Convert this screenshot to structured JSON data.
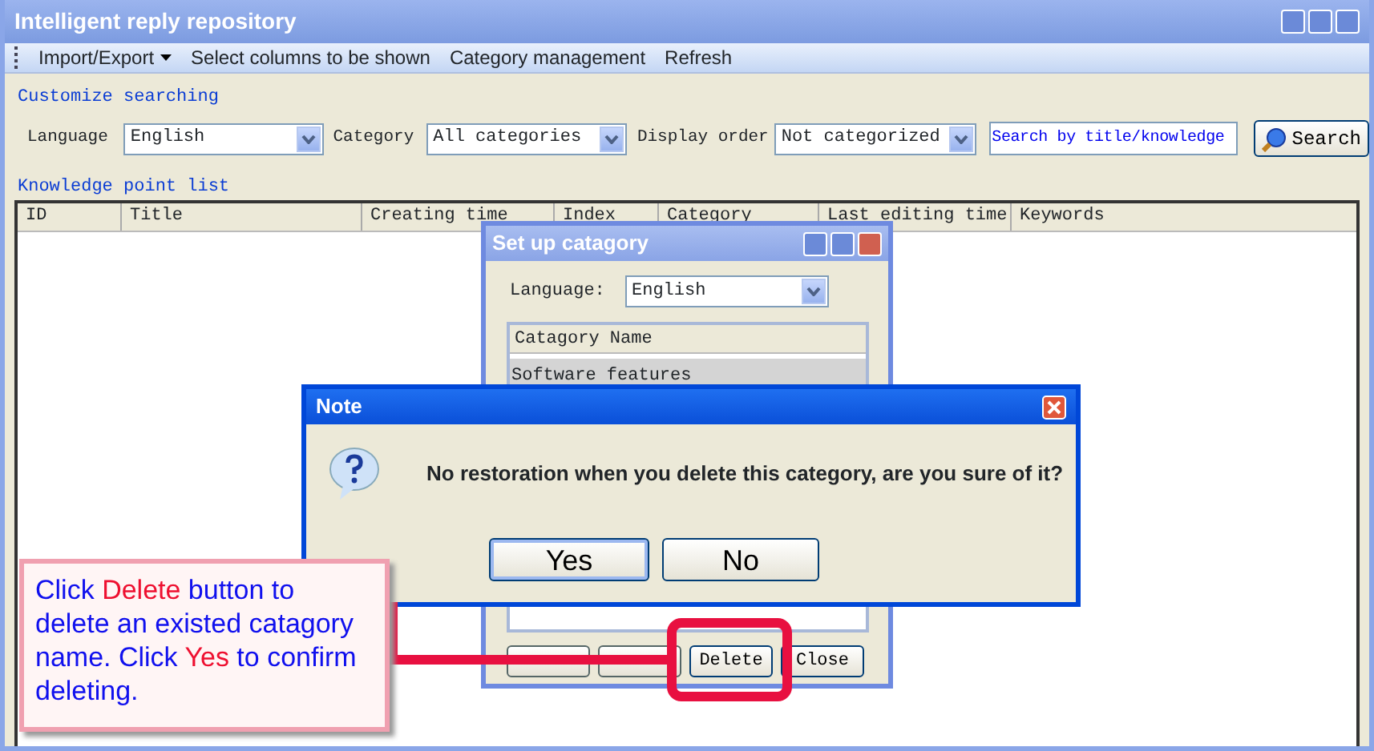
{
  "window": {
    "title": "Intelligent reply repository"
  },
  "menu": [
    {
      "label": "Import/Export",
      "dropdown": true
    },
    {
      "label": "Select columns to be shown",
      "dropdown": false
    },
    {
      "label": "Category management",
      "dropdown": false
    },
    {
      "label": "Refresh",
      "dropdown": false
    }
  ],
  "search": {
    "title": "Customize searching",
    "fields": [
      {
        "label": "Language",
        "value": "English"
      },
      {
        "label": "Category",
        "value": "All categories"
      },
      {
        "label": "Display order",
        "value": "Not categorized"
      }
    ],
    "search_box": {
      "value": "Search by title/knowledge"
    },
    "button": "Search"
  },
  "list": {
    "title": "Knowledge point list",
    "columns": [
      "ID",
      "Title",
      "Creating time",
      "Index",
      "Category",
      "Last editing time",
      "Keywords"
    ]
  },
  "category_dialog": {
    "title": "Set up catagory",
    "language_label": "Language:",
    "language_value": "English",
    "list_header": "Catagory Name",
    "items": [
      {
        "name": "Software features",
        "selected": true
      }
    ],
    "buttons": [
      "Delete",
      "Close"
    ]
  },
  "note_dialog": {
    "title": "Note",
    "message": "No restoration when you delete this category, are you sure of it?",
    "buttons": [
      {
        "label": "Yes",
        "focused": true
      },
      {
        "label": "No",
        "focused": false
      }
    ]
  },
  "callout": {
    "text": "Click **Delete** button to delete an existed catagory name. Click **Yes** to confirm deleting."
  }
}
